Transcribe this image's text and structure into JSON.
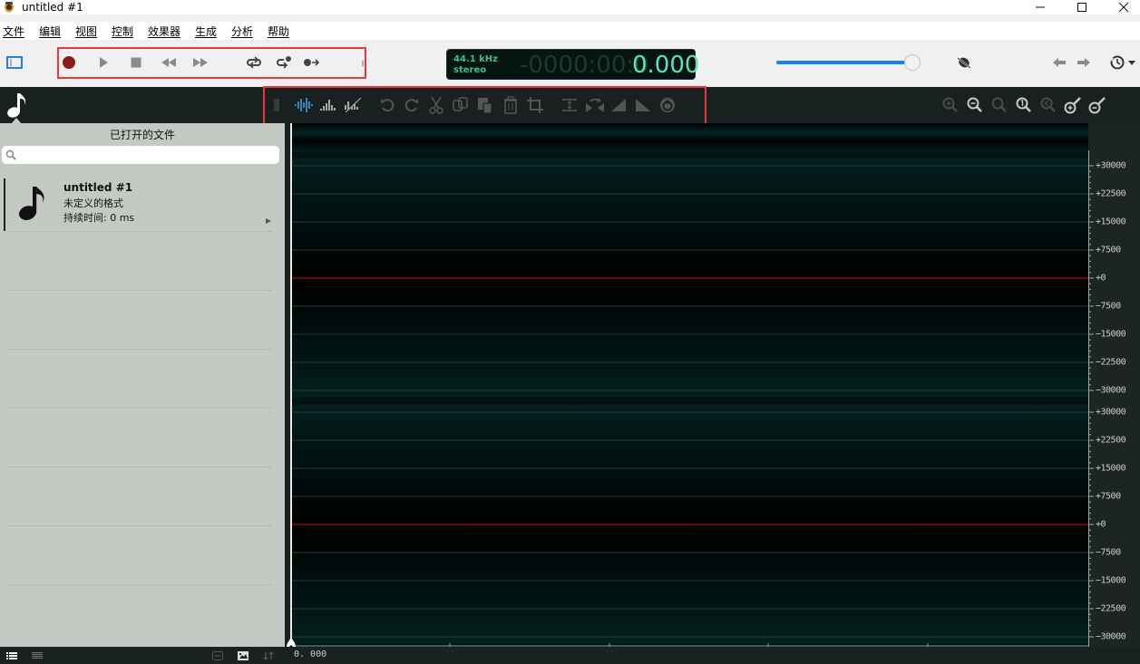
{
  "window": {
    "title": "untitled #1",
    "minimize_icon": "minimize-icon",
    "maximize_icon": "maximize-icon",
    "close_icon": "close-icon"
  },
  "menu": {
    "items": [
      {
        "label": "文件"
      },
      {
        "label": "编辑"
      },
      {
        "label": "视图"
      },
      {
        "label": "控制"
      },
      {
        "label": "效果器"
      },
      {
        "label": "生成"
      },
      {
        "label": "分析"
      },
      {
        "label": "帮助"
      }
    ]
  },
  "transport": {
    "buttons": [
      {
        "name": "record",
        "icon": "record-icon"
      },
      {
        "name": "play",
        "icon": "play-icon"
      },
      {
        "name": "stop",
        "icon": "stop-icon"
      },
      {
        "name": "rewind",
        "icon": "rewind-icon"
      },
      {
        "name": "fast-forward",
        "icon": "fast-forward-icon"
      },
      {
        "name": "loop",
        "icon": "loop-icon"
      },
      {
        "name": "loop-record",
        "icon": "loop-record-icon"
      },
      {
        "name": "follow-playhead",
        "icon": "follow-icon"
      }
    ],
    "colors": {
      "record": "#8b1c1c",
      "inactive": "#8a8a8a"
    }
  },
  "display": {
    "sample_rate": "44.1 kHz",
    "channels": "stereo",
    "time_dim": "-0000:00:0",
    "time_value": "0.000",
    "colors": {
      "background": "#061511",
      "text": "#5ee0b8",
      "dim": "#1d3a33"
    }
  },
  "volume": {
    "level_percent": 100,
    "accent": "#1a7ff5"
  },
  "nav": {
    "back_icon": "arrow-left-icon",
    "forward_icon": "arrow-right-icon",
    "history_icon": "history-icon"
  },
  "edit_toolbar": {
    "view_modes": [
      {
        "name": "waveform",
        "active": true
      },
      {
        "name": "spectrum",
        "active": false
      },
      {
        "name": "spectrogram",
        "active": false
      }
    ],
    "tools": [
      "undo",
      "redo",
      "cut",
      "copy",
      "paste",
      "delete",
      "crop",
      "normalize",
      "reverse",
      "fade-in",
      "fade-out",
      "amplify"
    ],
    "zoom_tools": [
      "zoom-in",
      "zoom-out",
      "zoom-selection",
      "zoom-fit",
      "zoom-in-disabled",
      "vertical-zoom-in",
      "vertical-zoom-out"
    ]
  },
  "sidebar": {
    "title": "已打开的文件",
    "search_placeholder": "",
    "files": [
      {
        "name": "untitled #1",
        "format": "未定义的格式",
        "duration": "持续时间: 0 ms"
      }
    ]
  },
  "waveform": {
    "channels": 2,
    "axis_labels": [
      "+30000",
      "+22500",
      "+15000",
      "+7500",
      "+0",
      "-7500",
      "-15000",
      "-22500",
      "-30000"
    ],
    "time_start": "0. 000",
    "colors": {
      "background": "#021413",
      "zero_line": "#a01010",
      "grid": "#2a3a38"
    }
  },
  "status_bar": {
    "icons": [
      "list-view-icon",
      "compact-list-icon",
      "link-icon",
      "image-icon",
      "sort-icon"
    ]
  }
}
